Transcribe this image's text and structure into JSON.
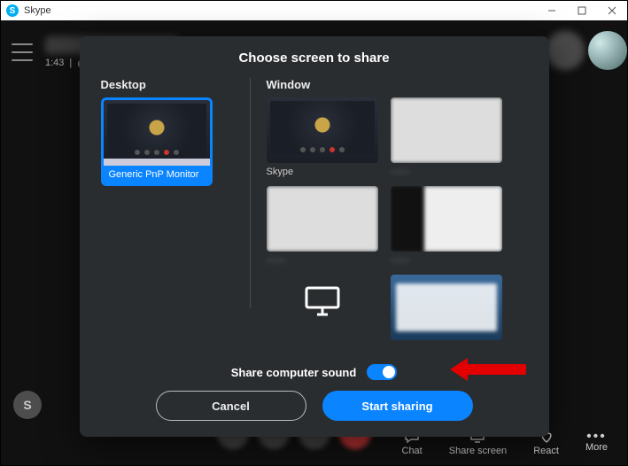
{
  "titlebar": {
    "app_name": "Skype"
  },
  "call": {
    "duration": "1:43",
    "initial_badge": "S",
    "toolbar": {
      "chat": "Chat",
      "share_screen": "Share screen",
      "react": "React",
      "more": "More"
    }
  },
  "modal": {
    "title": "Choose screen to share",
    "desktop_header": "Desktop",
    "window_header": "Window",
    "desktop_tile_label": "Generic PnP Monitor",
    "window_tiles": [
      {
        "label": "Skype",
        "blurred": false
      },
      {
        "label": "——",
        "blurred": true
      },
      {
        "label": "——",
        "blurred": true
      },
      {
        "label": "——",
        "blurred": true
      }
    ],
    "share_sound_label": "Share computer sound",
    "share_sound_on": true,
    "cancel_label": "Cancel",
    "start_label": "Start sharing"
  }
}
